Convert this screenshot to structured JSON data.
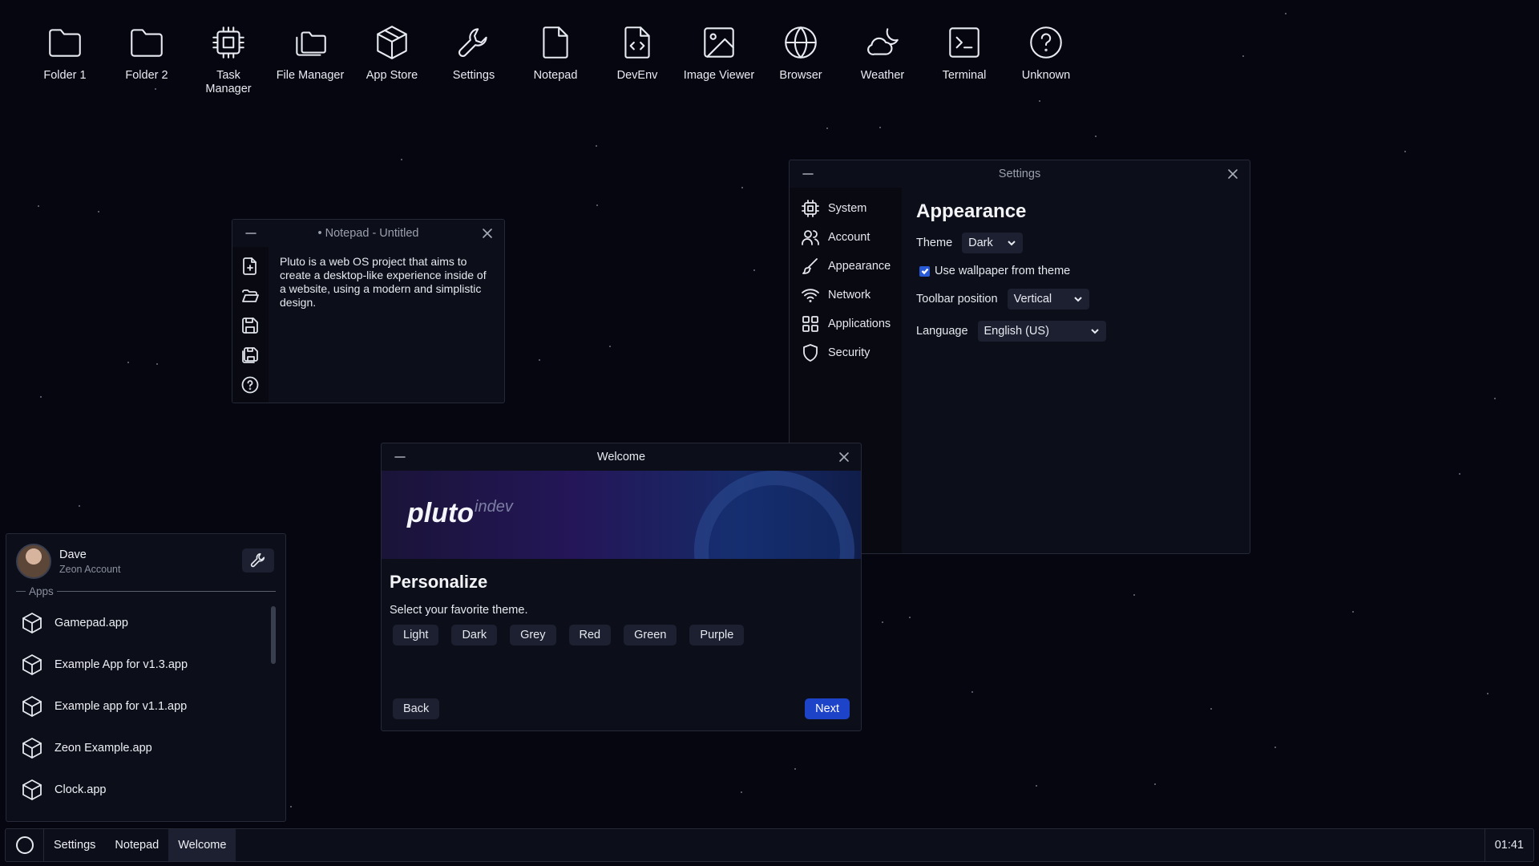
{
  "desktop": {
    "icons": [
      {
        "label": "Folder 1",
        "icon": "folder-icon"
      },
      {
        "label": "Folder 2",
        "icon": "folder-icon"
      },
      {
        "label": "Task Manager",
        "icon": "cpu-icon"
      },
      {
        "label": "File Manager",
        "icon": "folders-icon"
      },
      {
        "label": "App Store",
        "icon": "package-icon"
      },
      {
        "label": "Settings",
        "icon": "wrench-icon"
      },
      {
        "label": "Notepad",
        "icon": "file-icon"
      },
      {
        "label": "DevEnv",
        "icon": "code-file-icon"
      },
      {
        "label": "Image Viewer",
        "icon": "image-icon"
      },
      {
        "label": "Browser",
        "icon": "globe-icon"
      },
      {
        "label": "Weather",
        "icon": "cloud-moon-icon"
      },
      {
        "label": "Terminal",
        "icon": "terminal-icon"
      },
      {
        "label": "Unknown",
        "icon": "help-circle-icon"
      }
    ]
  },
  "notepad": {
    "title": "• Notepad - Untitled",
    "content": "Pluto is a web OS project that aims to create a desktop-like experience inside of a website, using a modern and simplistic design.",
    "toolbar": [
      "new-file-icon",
      "open-folder-icon",
      "save-icon",
      "save-as-icon",
      "help-icon"
    ]
  },
  "settings": {
    "title": "Settings",
    "nav": [
      {
        "label": "System",
        "icon": "cpu-icon"
      },
      {
        "label": "Account",
        "icon": "users-icon"
      },
      {
        "label": "Appearance",
        "icon": "brush-icon"
      },
      {
        "label": "Network",
        "icon": "wifi-icon"
      },
      {
        "label": "Applications",
        "icon": "grid-icon"
      },
      {
        "label": "Security",
        "icon": "shield-icon"
      }
    ],
    "heading": "Appearance",
    "theme_label": "Theme",
    "theme_value": "Dark",
    "wallpaper_label": "Use wallpaper from theme",
    "wallpaper_checked": true,
    "toolbar_label": "Toolbar position",
    "toolbar_value": "Vertical",
    "language_label": "Language",
    "language_value": "English (US)"
  },
  "welcome": {
    "title": "Welcome",
    "logo": "pluto",
    "tag": "indev",
    "heading": "Personalize",
    "subtitle": "Select your favorite theme.",
    "themes": [
      "Light",
      "Dark",
      "Grey",
      "Red",
      "Green",
      "Purple"
    ],
    "back": "Back",
    "next": "Next",
    "accent": "#1d43c9"
  },
  "startmenu": {
    "user_name": "Dave",
    "account": "Zeon Account",
    "apps_label": "Apps",
    "apps": [
      "Gamepad.app",
      "Example App for v1.3.app",
      "Example app for v1.1.app",
      "Zeon Example.app",
      "Clock.app"
    ]
  },
  "taskbar": {
    "tasks": [
      "Settings",
      "Notepad",
      "Welcome"
    ],
    "active": "Welcome",
    "clock": "01:41"
  }
}
